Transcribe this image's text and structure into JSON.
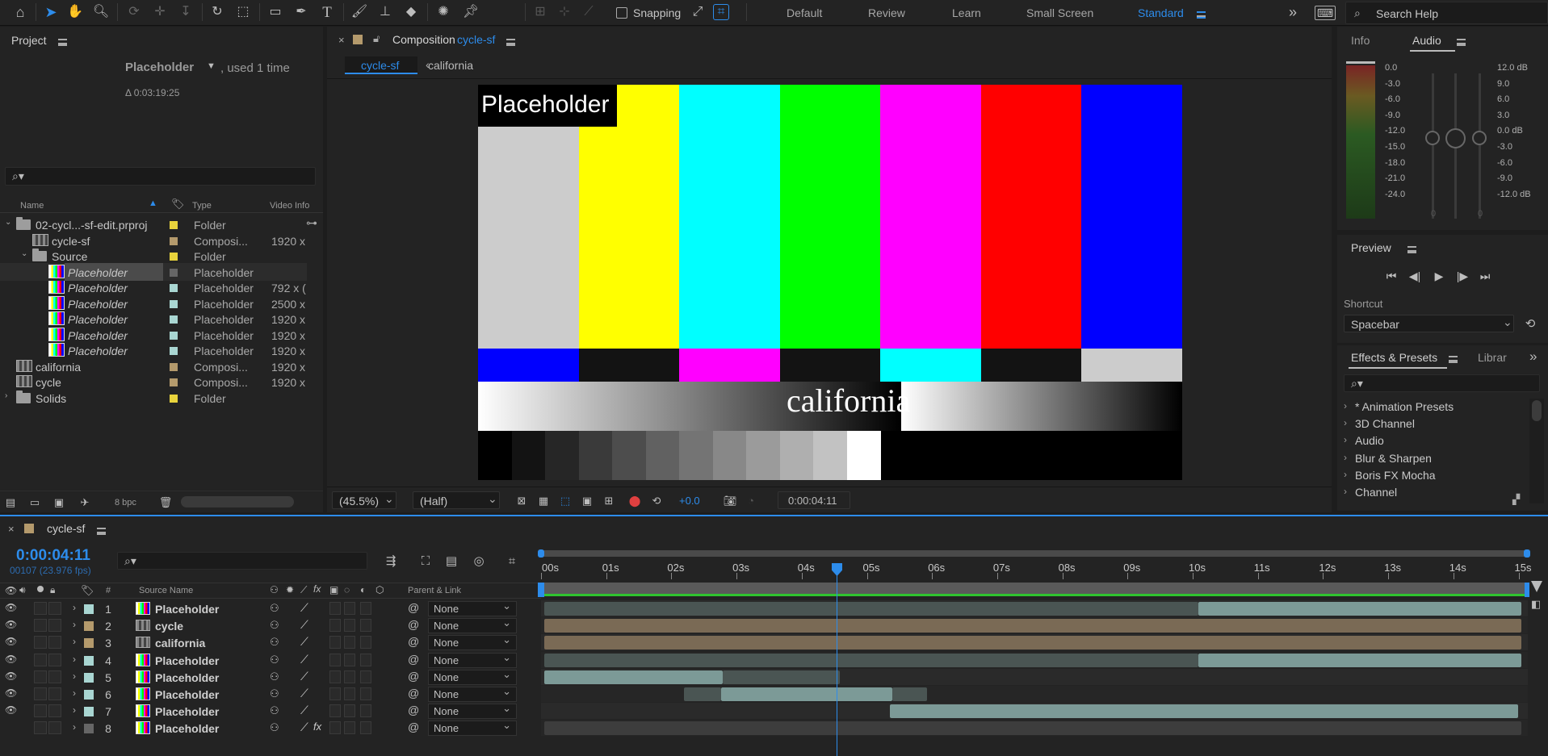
{
  "toolbar": {
    "snapping_label": "Snapping",
    "workspaces": [
      "Default",
      "Review",
      "Learn",
      "Small Screen",
      "Standard"
    ],
    "active_workspace": "Standard",
    "search_help": "Search Help"
  },
  "project": {
    "tab": "Project",
    "selected_name": "Placeholder",
    "used": ", used 1 time",
    "duration": "Δ 0:03:19:25",
    "columns": {
      "name": "Name",
      "type": "Type",
      "video_info": "Video Info"
    },
    "items": [
      {
        "name": "02-cycl...-sf-edit.prproj",
        "type": "Folder",
        "vinfo": "",
        "icon": "folder-icon",
        "color": "#e8d33c"
      },
      {
        "name": "cycle-sf",
        "type": "Composi...",
        "vinfo": "1920 x",
        "icon": "composition-icon",
        "color": "#b49a6c"
      },
      {
        "name": "Source",
        "type": "Folder",
        "vinfo": "",
        "icon": "folder-icon",
        "color": "#e8d33c"
      },
      {
        "name": "Placeholder",
        "type": "Placeholder",
        "vinfo": "",
        "icon": "placeholder-icon",
        "color": "#666666"
      },
      {
        "name": "Placeholder",
        "type": "Placeholder",
        "vinfo": "792 x (",
        "icon": "placeholder-icon",
        "color": "#a9d6d2"
      },
      {
        "name": "Placeholder",
        "type": "Placeholder",
        "vinfo": "2500 x",
        "icon": "placeholder-icon",
        "color": "#a9d6d2"
      },
      {
        "name": "Placeholder",
        "type": "Placeholder",
        "vinfo": "1920 x",
        "icon": "placeholder-icon",
        "color": "#a9d6d2"
      },
      {
        "name": "Placeholder",
        "type": "Placeholder",
        "vinfo": "1920 x",
        "icon": "placeholder-icon",
        "color": "#a9d6d2"
      },
      {
        "name": "Placeholder",
        "type": "Placeholder",
        "vinfo": "1920 x",
        "icon": "placeholder-icon",
        "color": "#a9d6d2"
      },
      {
        "name": "california",
        "type": "Composi...",
        "vinfo": "1920 x",
        "icon": "composition-icon",
        "color": "#b49a6c"
      },
      {
        "name": "cycle",
        "type": "Composi...",
        "vinfo": "1920 x",
        "icon": "composition-icon",
        "color": "#b49a6c"
      },
      {
        "name": "Solids",
        "type": "Folder",
        "vinfo": "",
        "icon": "folder-icon",
        "color": "#e8d33c"
      }
    ],
    "bpc": "8 bpc"
  },
  "viewer": {
    "tab_prefix": "Composition",
    "tab_comp": "cycle-sf",
    "breadcrumbs": [
      "cycle-sf",
      "california"
    ],
    "overlay_placeholder": "Placeholder",
    "overlay_california": "california",
    "zoom": "(45.5%)",
    "resolution": "(Half)",
    "exposure": "+0.0",
    "timecode": "0:00:04:11"
  },
  "info_audio": {
    "tabs": [
      "Info",
      "Audio"
    ],
    "left_scale": [
      "0.0",
      "-3.0",
      "-6.0",
      "-9.0",
      "-12.0",
      "-15.0",
      "-18.0",
      "-21.0",
      "-24.0"
    ],
    "right_scale": [
      "12.0 dB",
      "9.0",
      "6.0",
      "3.0",
      "0.0 dB",
      "-3.0",
      "-6.0",
      "-9.0",
      "-12.0 dB"
    ],
    "knob_values": [
      "0",
      "0"
    ]
  },
  "preview": {
    "tab": "Preview",
    "shortcut_label": "Shortcut",
    "shortcut_value": "Spacebar"
  },
  "effects": {
    "tab": "Effects & Presets",
    "tab2": "Librar",
    "items": [
      "* Animation Presets",
      "3D Channel",
      "Audio",
      "Blur & Sharpen",
      "Boris FX Mocha",
      "Channel"
    ]
  },
  "timeline": {
    "tab": "cycle-sf",
    "timecode": "0:00:04:11",
    "frames": "00107 (23.976 fps)",
    "col_source": "Source Name",
    "col_num": "#",
    "col_parent": "Parent & Link",
    "ruler": [
      "00s",
      "01s",
      "02s",
      "03s",
      "04s",
      "05s",
      "06s",
      "07s",
      "08s",
      "09s",
      "10s",
      "11s",
      "12s",
      "13s",
      "14s",
      "15s"
    ],
    "layers": [
      {
        "num": "1",
        "name": "Placeholder",
        "parent": "None",
        "color": "#a9d6d2",
        "icon": "placeholder"
      },
      {
        "num": "2",
        "name": "cycle",
        "parent": "None",
        "color": "#b49a6c",
        "icon": "comp"
      },
      {
        "num": "3",
        "name": "california",
        "parent": "None",
        "color": "#b49a6c",
        "icon": "comp"
      },
      {
        "num": "4",
        "name": "Placeholder",
        "parent": "None",
        "color": "#a9d6d2",
        "icon": "placeholder"
      },
      {
        "num": "5",
        "name": "Placeholder",
        "parent": "None",
        "color": "#a9d6d2",
        "icon": "placeholder"
      },
      {
        "num": "6",
        "name": "Placeholder",
        "parent": "None",
        "color": "#a9d6d2",
        "icon": "placeholder"
      },
      {
        "num": "7",
        "name": "Placeholder",
        "parent": "None",
        "color": "#a9d6d2",
        "icon": "placeholder"
      },
      {
        "num": "8",
        "name": "Placeholder",
        "parent": "None",
        "color": "#666666",
        "icon": "placeholder"
      }
    ]
  }
}
